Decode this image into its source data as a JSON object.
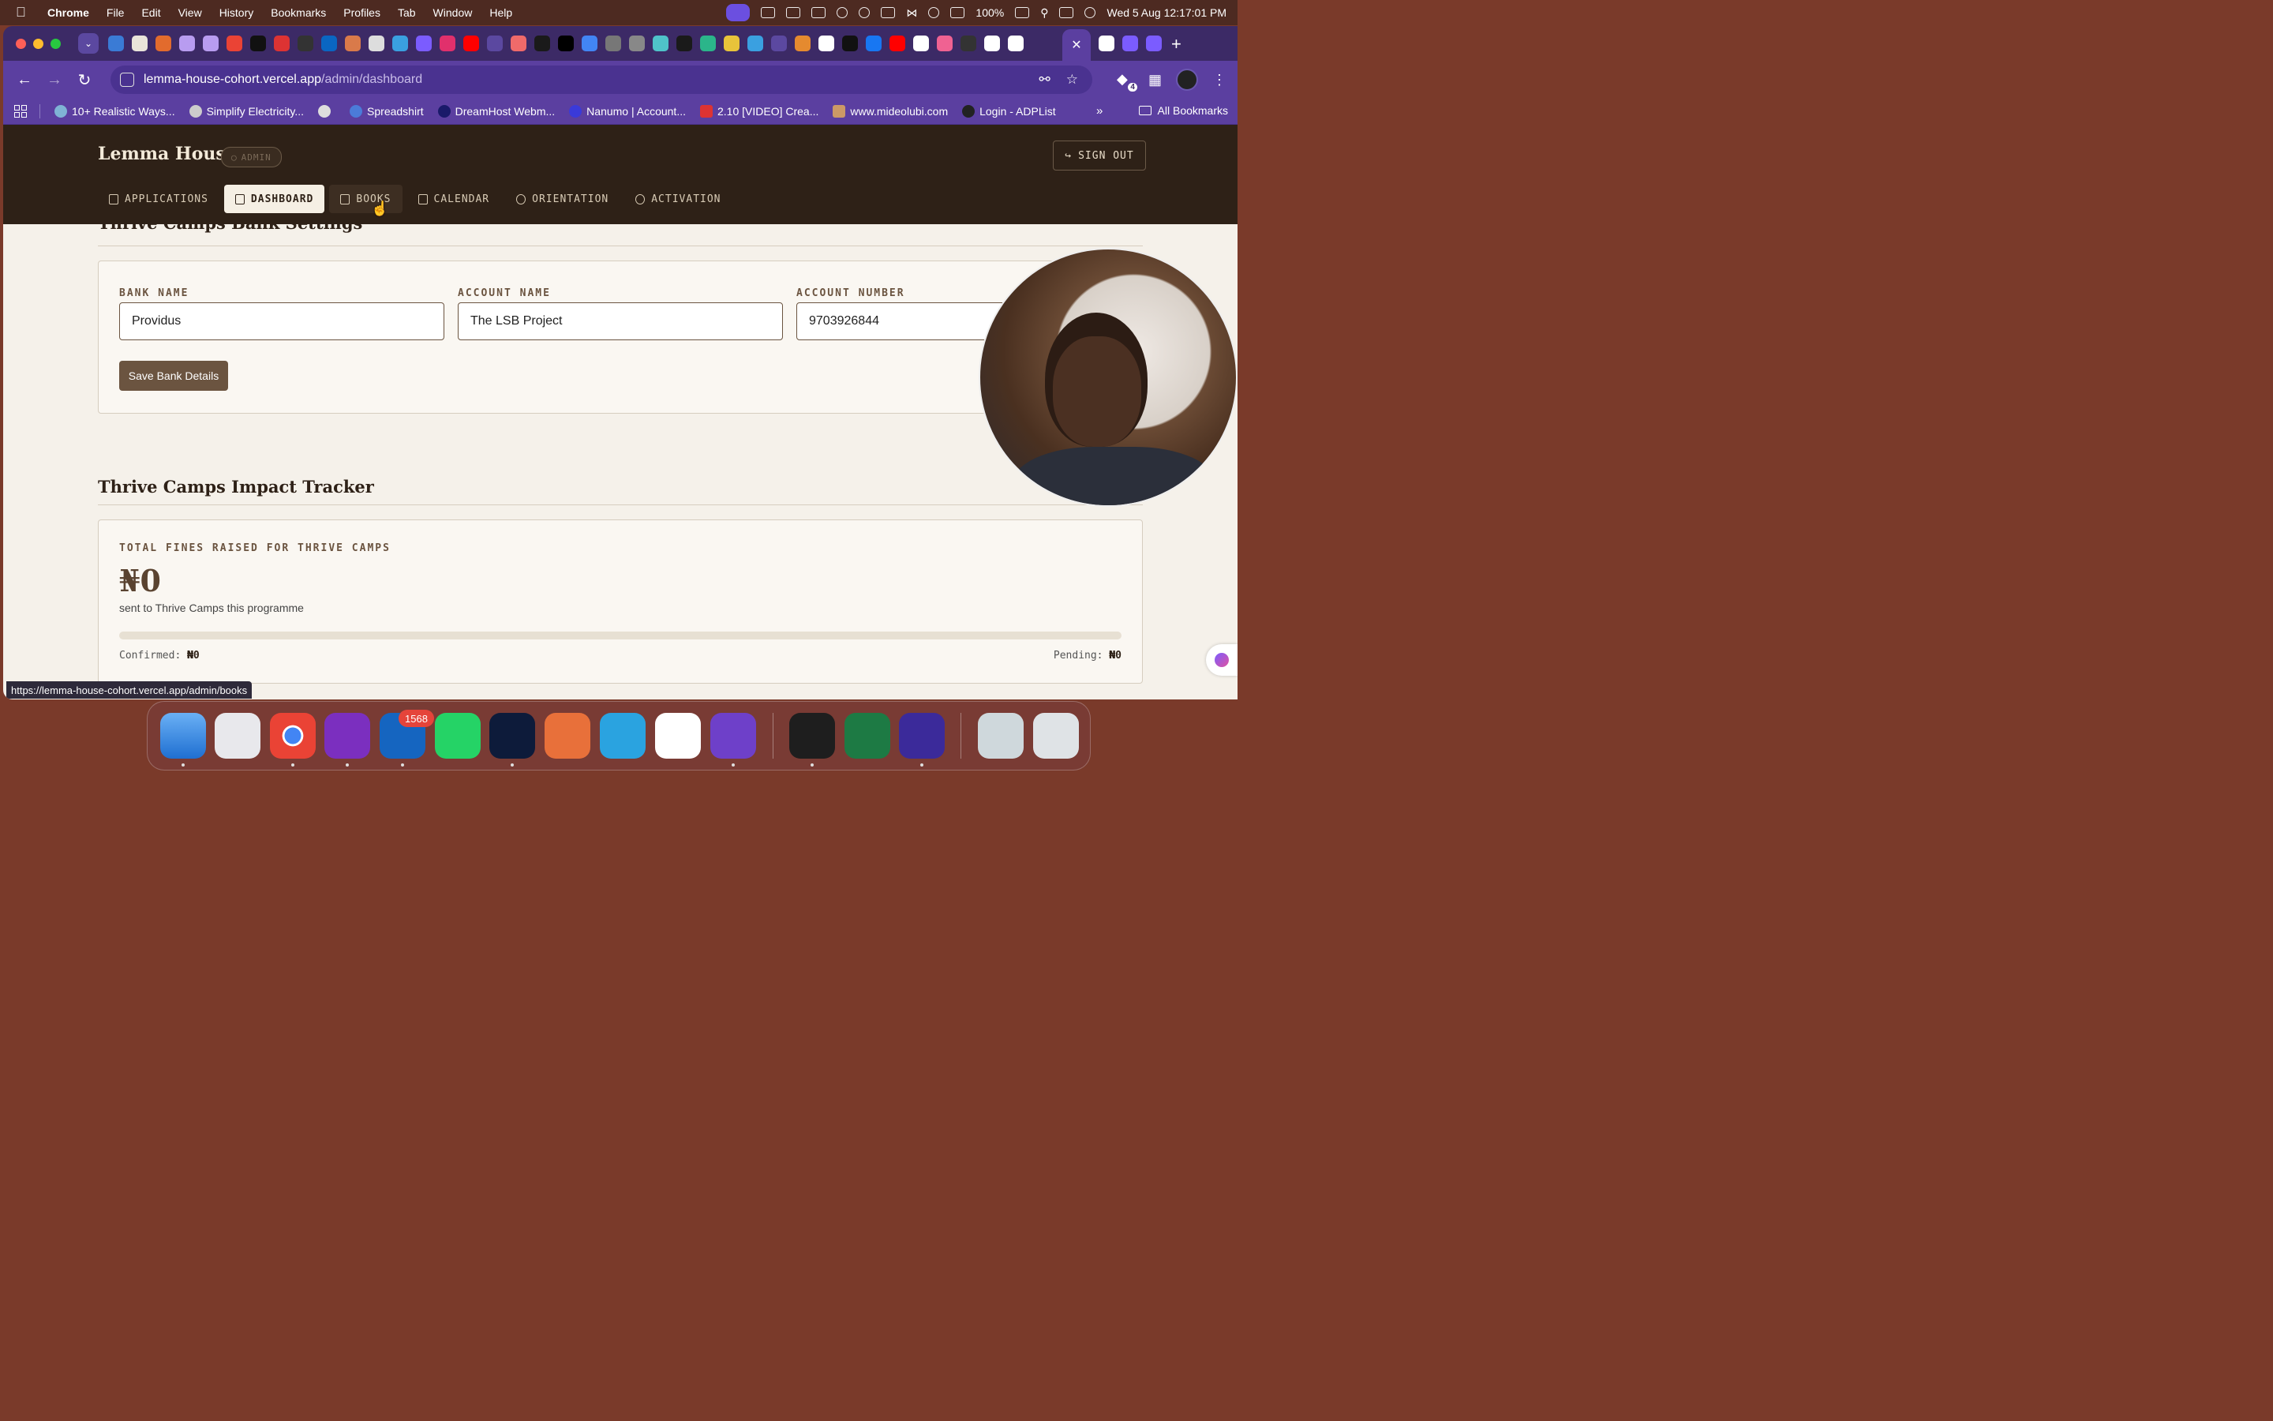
{
  "menubar": {
    "app_name": "Chrome",
    "items": [
      "File",
      "Edit",
      "View",
      "History",
      "Bookmarks",
      "Profiles",
      "Tab",
      "Window",
      "Help"
    ],
    "battery": "100%",
    "datetime": "Wed 5 Aug  12:17:01 PM"
  },
  "browser": {
    "url_host": "lemma-house-cohort.vercel.app",
    "url_path": "/admin/dashboard",
    "extensions_badge": "4",
    "bookmarks": [
      {
        "label": "10+ Realistic Ways..."
      },
      {
        "label": "Simplify Electricity..."
      },
      {
        "label": ""
      },
      {
        "label": "Spreadshirt"
      },
      {
        "label": "DreamHost Webm..."
      },
      {
        "label": "Nanumo | Account..."
      },
      {
        "label": "2.10 [VIDEO] Crea..."
      },
      {
        "label": "www.mideolubi.com"
      },
      {
        "label": "Login - ADPList"
      }
    ],
    "more_bookmarks": "»",
    "all_bookmarks": "All Bookmarks",
    "status_url": "https://lemma-house-cohort.vercel.app/admin/books"
  },
  "site": {
    "brand": "Lemma House",
    "admin_badge": "ADMIN",
    "sign_out": "SIGN OUT",
    "nav": [
      {
        "label": "APPLICATIONS",
        "icon": "document-icon"
      },
      {
        "label": "DASHBOARD",
        "icon": "grid-icon",
        "active": true
      },
      {
        "label": "BOOKS",
        "icon": "book-icon"
      },
      {
        "label": "CALENDAR",
        "icon": "calendar-icon"
      },
      {
        "label": "ORIENTATION",
        "icon": "users-icon"
      },
      {
        "label": "ACTIVATION",
        "icon": "user-check-icon"
      }
    ]
  },
  "bank_settings": {
    "title": "Thrive Camps Bank Settings",
    "bank_name_label": "BANK NAME",
    "bank_name": "Providus",
    "account_name_label": "ACCOUNT NAME",
    "account_name": "The LSB Project",
    "account_number_label": "ACCOUNT NUMBER",
    "account_number": "9703926844",
    "save_label": "Save Bank Details"
  },
  "impact": {
    "title": "Thrive Camps Impact Tracker",
    "label": "TOTAL FINES RAISED FOR THRIVE CAMPS",
    "value": "₦0",
    "sub": "sent to Thrive Camps this programme",
    "progress": 0,
    "confirmed_label": "Confirmed:",
    "confirmed_value": "₦0",
    "pending_label": "Pending:",
    "pending_value": "₦0"
  },
  "dock": {
    "outlook_badge": "1568"
  },
  "colors": {
    "header_bg": "#2e2117",
    "accent": "#6b5440",
    "page_bg": "#f5f1ea",
    "browser_purple": "#5b3fa0"
  }
}
